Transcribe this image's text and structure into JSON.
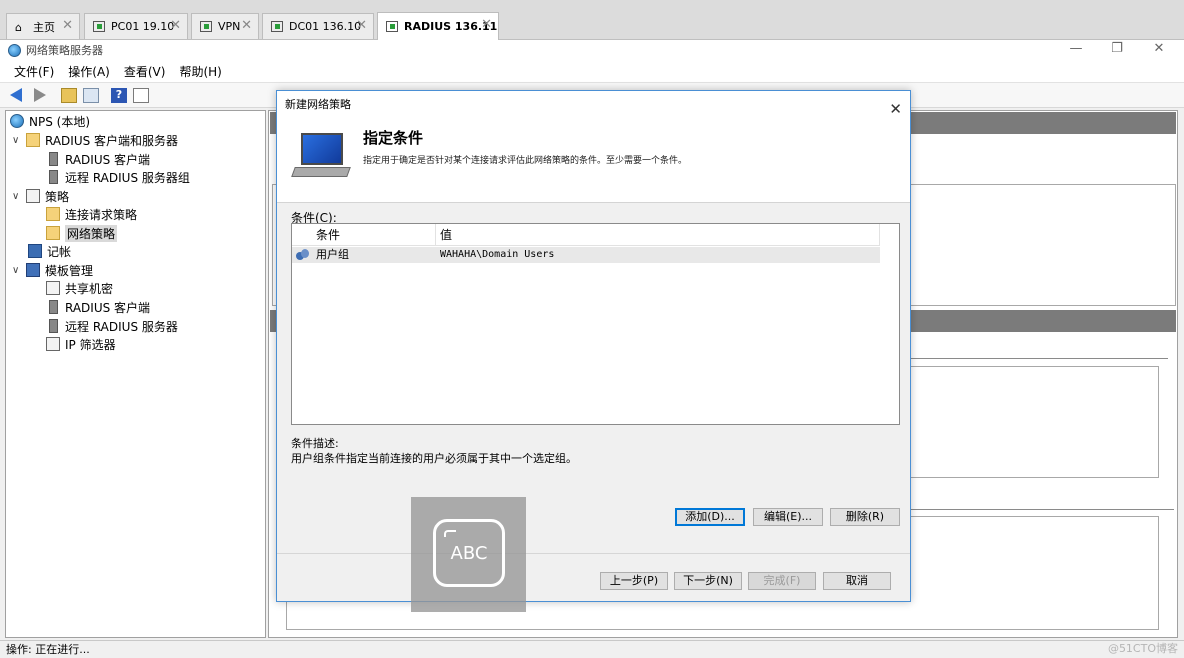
{
  "tabs": [
    {
      "label": "主页",
      "icon": "home-icon"
    },
    {
      "label": "PC01  19.10",
      "icon": "vm-icon"
    },
    {
      "label": "VPN",
      "icon": "vm-icon"
    },
    {
      "label": "DC01  136.10",
      "icon": "vm-icon"
    },
    {
      "label": "RADIUS  136.11",
      "icon": "vm-icon",
      "active": true
    }
  ],
  "window": {
    "title": "网络策略服务器"
  },
  "menu": [
    "文件(F)",
    "操作(A)",
    "查看(V)",
    "帮助(H)"
  ],
  "tree": [
    {
      "label": "NPS (本地)",
      "level": 0,
      "icon": "globe-icon"
    },
    {
      "label": "RADIUS 客户端和服务器",
      "level": 1,
      "icon": "folder-icon",
      "expanded": true
    },
    {
      "label": "RADIUS 客户端",
      "level": 2,
      "icon": "server-icon"
    },
    {
      "label": "远程 RADIUS 服务器组",
      "level": 2,
      "icon": "server-icon"
    },
    {
      "label": "策略",
      "level": 1,
      "icon": "doc-icon",
      "expanded": true
    },
    {
      "label": "连接请求策略",
      "level": 2,
      "icon": "folder-icon"
    },
    {
      "label": "网络策略",
      "level": 2,
      "icon": "folder-icon",
      "selected": true
    },
    {
      "label": "记帐",
      "level": 1,
      "icon": "log-icon"
    },
    {
      "label": "模板管理",
      "level": 1,
      "icon": "mgmt-icon",
      "expanded": true
    },
    {
      "label": "共享机密",
      "level": 2,
      "icon": "doc-icon"
    },
    {
      "label": "RADIUS 客户端",
      "level": 2,
      "icon": "server-icon"
    },
    {
      "label": "远程 RADIUS 服务器",
      "level": 2,
      "icon": "server-icon"
    },
    {
      "label": "IP 筛选器",
      "level": 2,
      "icon": "doc-icon"
    }
  ],
  "dialog": {
    "title": "新建网络策略",
    "heading": "指定条件",
    "subheading": "指定用于确定是否针对某个连接请求评估此网络策略的条件。至少需要一个条件。",
    "conditions_label": "条件(C):",
    "columns": [
      "条件",
      "值"
    ],
    "rows": [
      {
        "condition": "用户组",
        "value": "WAHAHA\\Domain Users"
      }
    ],
    "desc_label": "条件描述:",
    "desc_text": "用户组条件指定当前连接的用户必须属于其中一个选定组。",
    "buttons": {
      "add": "添加(D)...",
      "edit": "编辑(E)...",
      "remove": "删除(R)",
      "prev": "上一步(P)",
      "next": "下一步(N)",
      "finish": "完成(F)",
      "cancel": "取消"
    }
  },
  "overlay": {
    "text": "ABC"
  },
  "status": {
    "text": "操作:  正在进行..."
  },
  "watermark": "@51CTO博客"
}
